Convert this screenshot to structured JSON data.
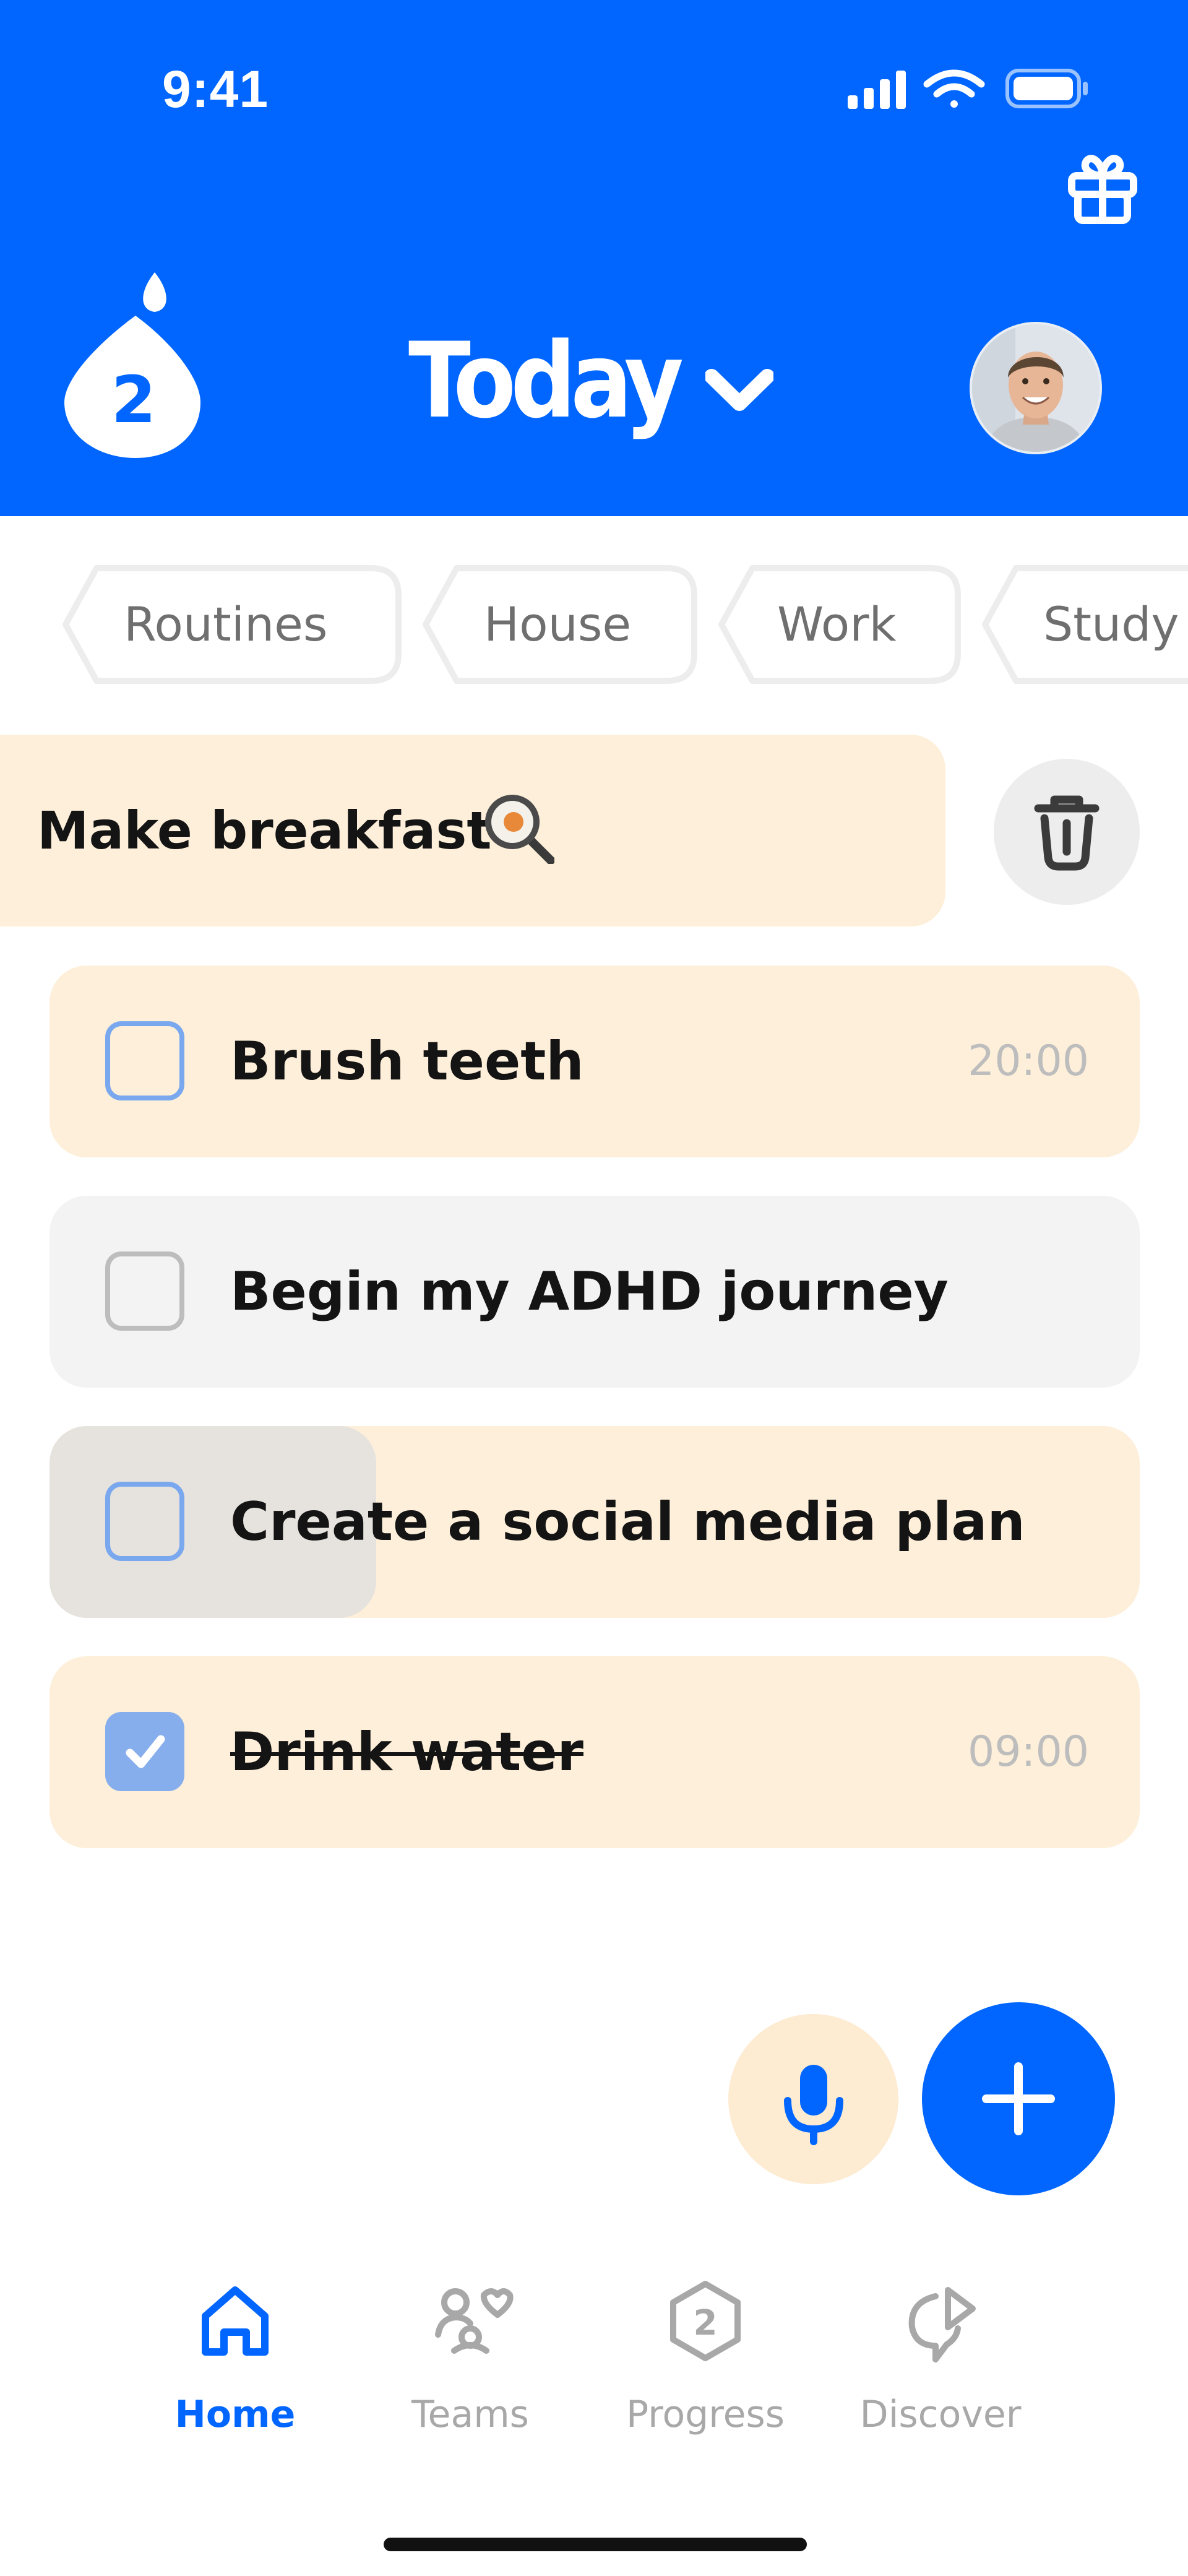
{
  "status_bar": {
    "time": "9:41"
  },
  "header": {
    "title": "Today",
    "streak_count": "2",
    "colors": {
      "brand": "#0066ff"
    }
  },
  "categories": [
    "Routines",
    "House",
    "Work",
    "Study"
  ],
  "swiped_task": {
    "label": "Make breakfast",
    "emoji_icon": "frying-pan-icon"
  },
  "tasks": [
    {
      "label": "Brush teeth",
      "time": "20:00",
      "checked": false
    },
    {
      "label": "Begin my ADHD journey",
      "time": "",
      "checked": false
    },
    {
      "label": "Create a social media plan",
      "time": "",
      "checked": false
    },
    {
      "label": "Drink water",
      "time": "09:00",
      "checked": true
    }
  ],
  "bottom_nav": [
    {
      "label": "Home",
      "icon": "home-icon",
      "active": true
    },
    {
      "label": "Teams",
      "icon": "teams-icon",
      "active": false
    },
    {
      "label": "Progress",
      "icon": "progress-icon",
      "badge": "2",
      "active": false
    },
    {
      "label": "Discover",
      "icon": "discover-icon",
      "active": false
    }
  ]
}
